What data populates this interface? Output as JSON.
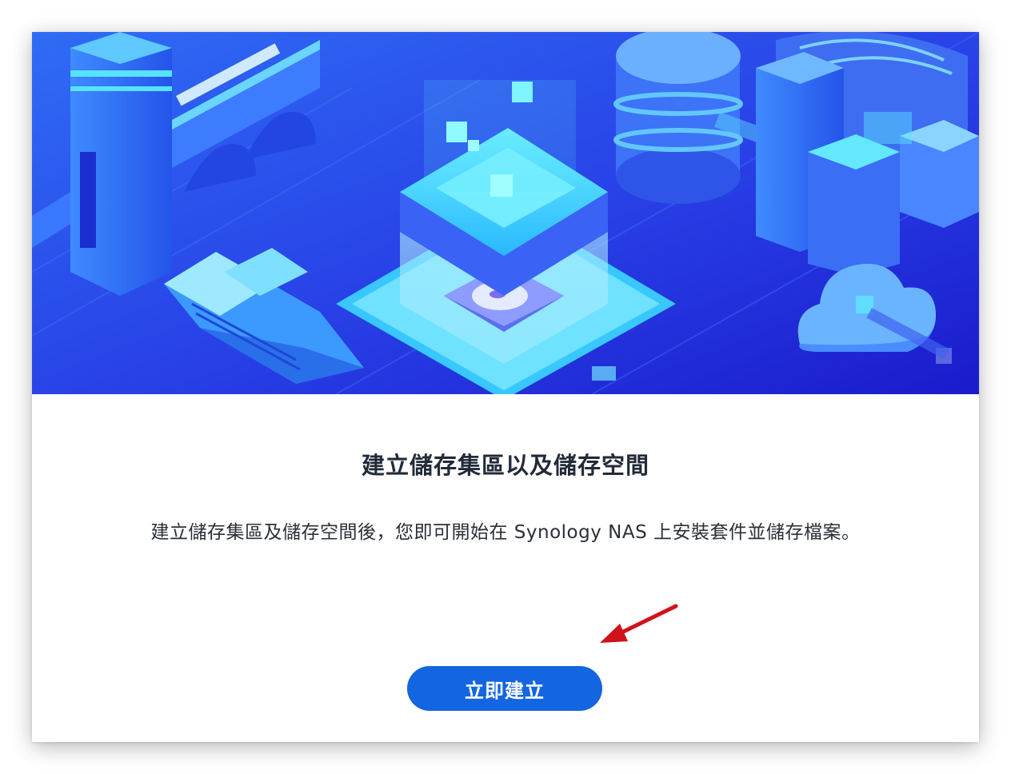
{
  "dialog": {
    "title": "建立儲存集區以及儲存空間",
    "description": "建立儲存集區及儲存空間後，您即可開始在 Synology NAS 上安裝套件並儲存檔案。",
    "create_button_label": "立即建立"
  },
  "colors": {
    "hero_background": "#2a37e0",
    "button": "#1466e0",
    "annotation_arrow": "#d0121b"
  },
  "icons": [
    "storage-illustration",
    "hard-disk-icon",
    "cloud-icon",
    "database-icon",
    "arrow-annotation"
  ]
}
